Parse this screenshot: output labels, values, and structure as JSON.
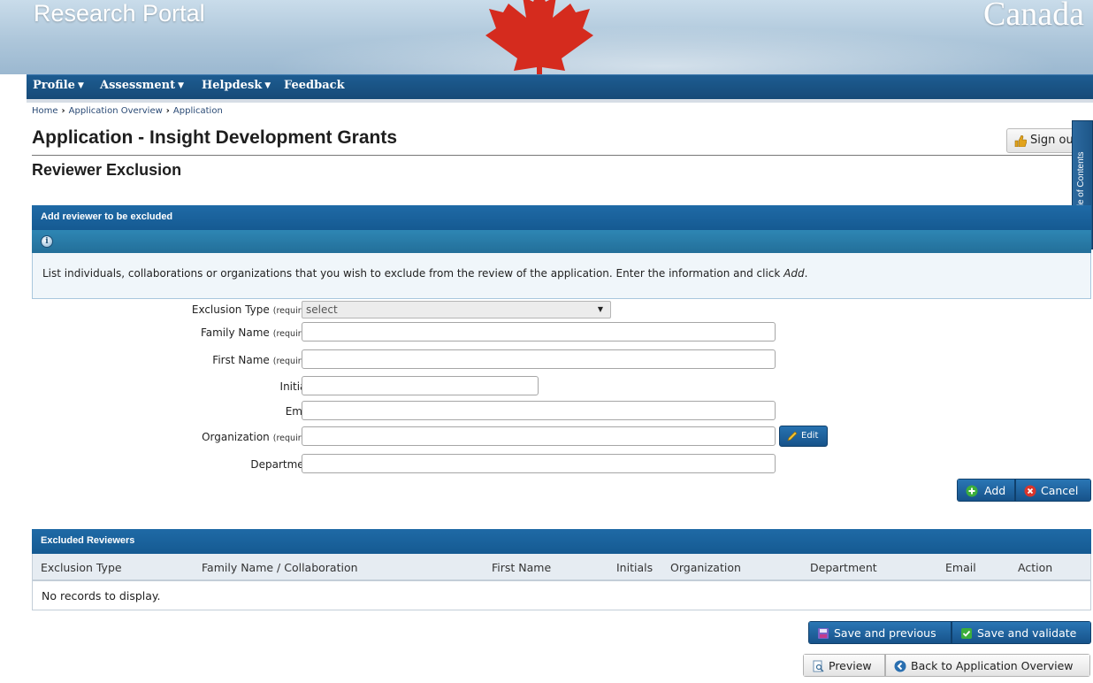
{
  "header": {
    "portal_title": "Research Portal",
    "gov_wordmark": "Canada"
  },
  "nav": {
    "items": [
      {
        "label": "Profile",
        "has_menu": true
      },
      {
        "label": "Assessment",
        "has_menu": true
      },
      {
        "label": "Helpdesk",
        "has_menu": true
      },
      {
        "label": "Feedback",
        "has_menu": false
      }
    ]
  },
  "breadcrumb": [
    "Home",
    "Application Overview",
    "Application"
  ],
  "page": {
    "title": "Application - Insight Development Grants",
    "subtitle": "Reviewer Exclusion",
    "signout_label": "Sign out",
    "toc_tab_label": "Show Table of Contents"
  },
  "add_panel": {
    "title": "Add reviewer to be excluded",
    "info_text_start": "List individuals, collaborations or organizations that you wish to exclude from the review of the application. Enter the information and click ",
    "info_text_action": "Add",
    "info_text_end": ".",
    "required_tag": "(required)",
    "fields": {
      "exclusion_type": {
        "label": "Exclusion Type",
        "value": "select",
        "required": true
      },
      "family_name": {
        "label": "Family Name",
        "value": "",
        "required": true
      },
      "first_name": {
        "label": "First Name",
        "value": "",
        "required": true
      },
      "initials": {
        "label": "Initials",
        "value": "",
        "required": false
      },
      "email": {
        "label": "Email",
        "value": "",
        "required": false
      },
      "organization": {
        "label": "Organization",
        "value": "",
        "required": true
      },
      "department": {
        "label": "Department",
        "value": "",
        "required": false
      }
    },
    "edit_label": "Edit",
    "add_label": "Add",
    "cancel_label": "Cancel"
  },
  "excluded_panel": {
    "title": "Excluded Reviewers",
    "columns": [
      "Exclusion Type",
      "Family Name / Collaboration",
      "First Name",
      "Initials",
      "Organization",
      "Department",
      "Email",
      "Action"
    ],
    "empty_text": "No records to display."
  },
  "footer_buttons": {
    "save_previous": "Save and previous",
    "save_validate": "Save and validate",
    "preview": "Preview",
    "back_overview": "Back to Application Overview"
  },
  "colors": {
    "nav_blue": "#164a78",
    "panel_blue": "#155a92",
    "info_teal": "#236f99",
    "maple_red": "#d52b1e"
  }
}
